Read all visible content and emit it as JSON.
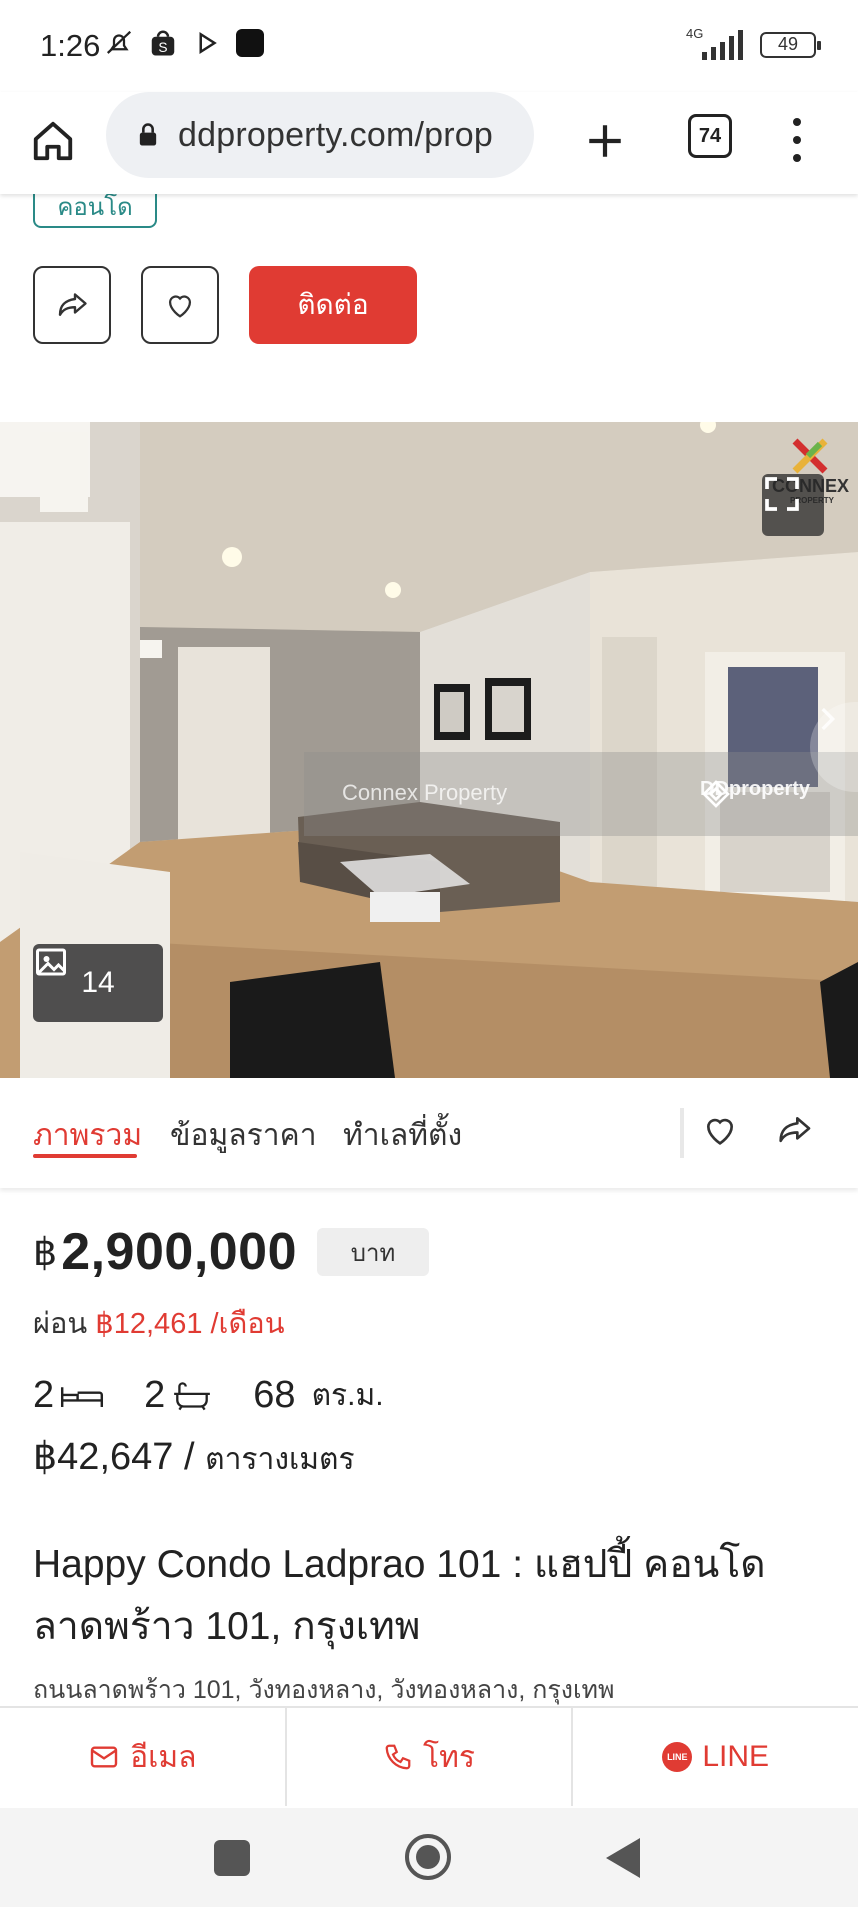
{
  "status_bar": {
    "time": "1:26",
    "network": "4G",
    "battery": "49",
    "icons": [
      "bell-off-icon",
      "shopee-icon",
      "play-icon",
      "app-icon",
      "signal-icon"
    ]
  },
  "browser": {
    "url": "ddproperty.com/prop",
    "tab_count": "74",
    "icons": [
      "home-icon",
      "lock-icon",
      "plus-icon",
      "menu-icon"
    ]
  },
  "listing": {
    "type_tag": "คอนโด",
    "contact_label": "ติดต่อ",
    "photo_count": "14",
    "watermark": "Connex Property",
    "watermark_brand": "DDproperty",
    "logo_text": "CONNEX",
    "logo_sub": "PROPERTY"
  },
  "tabs": [
    {
      "label": "ภาพรวม",
      "active": true
    },
    {
      "label": "ข้อมูลราคา",
      "active": false
    },
    {
      "label": "ทำเลที่ตั้ง",
      "active": false
    }
  ],
  "price": {
    "currency": "฿",
    "value": "2,900,000",
    "unit": "บาท",
    "installment_label": "ผ่อน",
    "installment_amount": "฿12,461 /เดือน"
  },
  "specs": {
    "bedrooms": "2",
    "bathrooms": "2",
    "area": "68",
    "area_unit": "ตร.ม.",
    "price_per_sqm": "฿42,647 /",
    "price_per_sqm_unit": "ตารางเมตร"
  },
  "title": "Happy Condo Ladprao 101 : แฮปปี้ คอนโด ลาดพร้าว 101, กรุงเทพ",
  "address": "ถนนลาดพร้าว 101, วังทองหลาง, วังทองหลาง, กรุงเทพ",
  "contact_bar": {
    "email": "อีเมล",
    "phone": "โทร",
    "line": "LINE",
    "line_badge": "LINE"
  },
  "colors": {
    "accent": "#e03b33",
    "tag": "#2a8a87"
  }
}
